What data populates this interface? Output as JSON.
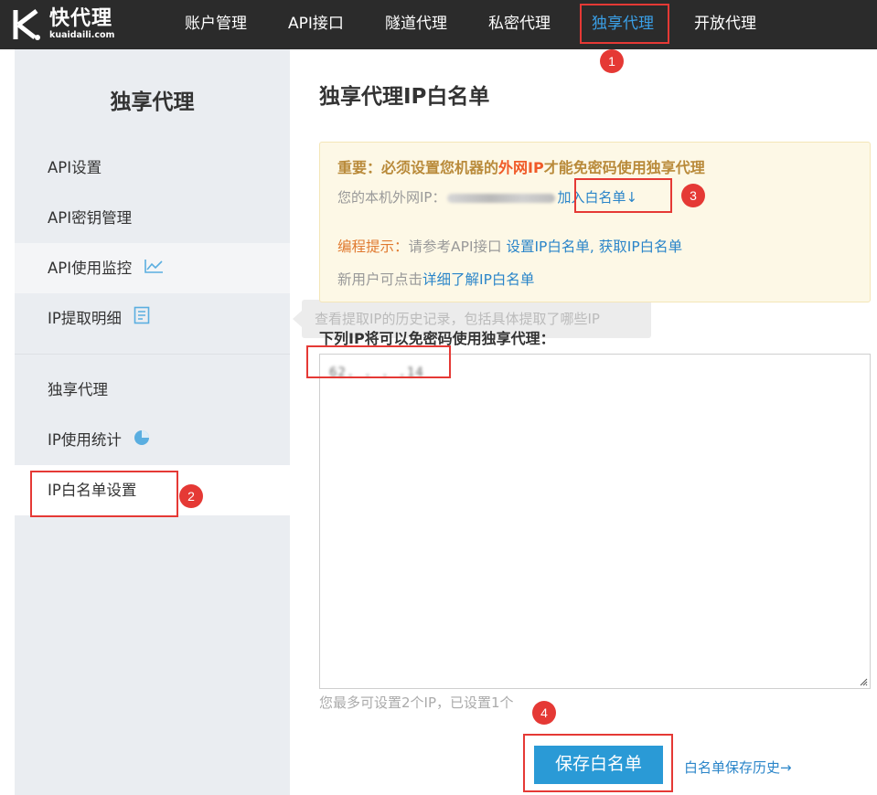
{
  "header": {
    "logo_title": "快代理",
    "logo_domain": "kuaidaili.com",
    "nav": [
      "账户管理",
      "API接口",
      "隧道代理",
      "私密代理",
      "独享代理",
      "开放代理"
    ],
    "active_nav": "独享代理",
    "accent_color": "#3aa0e8"
  },
  "annotations": {
    "n1": "1",
    "n2": "2",
    "n3": "3",
    "n4": "4"
  },
  "sidebar": {
    "title": "独享代理",
    "items": [
      "API设置",
      "API密钥管理",
      "API使用监控",
      "IP提取明细",
      "独享代理",
      "IP使用统计",
      "IP白名单设置"
    ],
    "active_item": "IP白名单设置",
    "icons": {
      "API使用监控": "line-chart-icon",
      "IP提取明细": "document-icon",
      "IP使用统计": "pie-chart-icon"
    }
  },
  "tooltip": {
    "text": "查看提取IP的历史记录，包括具体提取了哪些IP"
  },
  "main": {
    "title": "独享代理IP白名单",
    "notice": {
      "important_prefix": "重要：必须设置您机器的",
      "important_red": "外网IP",
      "important_suffix": "才能免密码使用独享代理",
      "ip_label": "您的本机外网IP：",
      "add_whitelist": "加入白名单↓",
      "tip_prefix": "编程提示：",
      "tip_text": "请参考API接口 ",
      "tip_link_set": "设置IP白名单",
      "tip_comma": ", ",
      "tip_link_get": "获取IP白名单",
      "new_user_text": "新用户可点击",
      "new_user_link": "详细了解IP白名单"
    },
    "list_label": "下列IP将可以免密码使用独享代理：",
    "textarea_value": "62.  .  .  .14",
    "limit_text": "您最多可设置2个IP，已设置1个",
    "save_button": "保存白名单",
    "history_link": "白名单保存历史→"
  }
}
